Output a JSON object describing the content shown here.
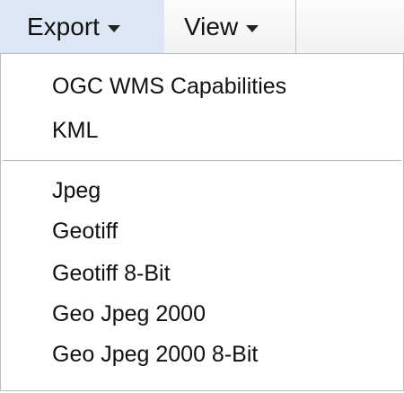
{
  "menubar": {
    "export_label": "Export",
    "view_label": "View"
  },
  "export_menu": {
    "group_one": [
      "OGC WMS Capabilities",
      "KML"
    ],
    "group_two": [
      "Jpeg",
      "Geotiff",
      "Geotiff 8-Bit",
      "Geo Jpeg 2000",
      "Geo Jpeg 2000 8-Bit"
    ]
  },
  "colors": {
    "active_menu_background": "#dde6f4",
    "menubar_background": "#f5f5f5",
    "text": "#111111"
  }
}
